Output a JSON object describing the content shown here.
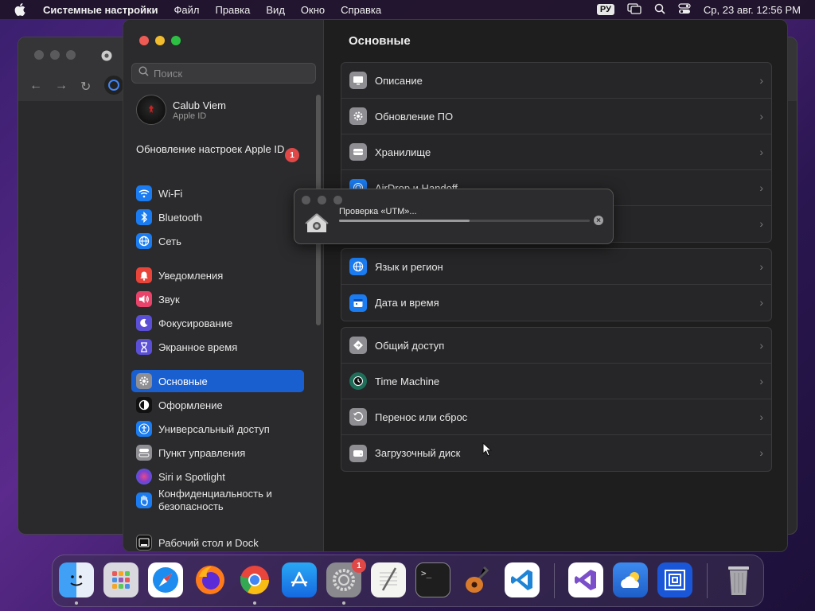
{
  "menubar": {
    "app_name": "Системные настройки",
    "items": [
      "Файл",
      "Правка",
      "Вид",
      "Окно",
      "Справка"
    ],
    "lang": "РУ",
    "datetime": "Ср, 23 авг.  12:56 PM"
  },
  "sidebar": {
    "search_placeholder": "Поиск",
    "profile_name": "Calub Viem",
    "profile_sub": "Apple ID",
    "update_text": "Обновление настроек Apple ID",
    "update_badge": "1",
    "items": [
      {
        "label": "Wi-Fi",
        "icon": "wifi-icon",
        "color": "#1a7cf0"
      },
      {
        "label": "Bluetooth",
        "icon": "bluetooth-icon",
        "color": "#1a7cf0"
      },
      {
        "label": "Сеть",
        "icon": "globe-icon",
        "color": "#1a7cf0"
      },
      {
        "label": "Уведомления",
        "icon": "bell-icon",
        "color": "#e8443a"
      },
      {
        "label": "Звук",
        "icon": "speaker-icon",
        "color": "#e8436a"
      },
      {
        "label": "Фокусирование",
        "icon": "moon-icon",
        "color": "#5b4fd6"
      },
      {
        "label": "Экранное время",
        "icon": "hourglass-icon",
        "color": "#5b4fd6"
      },
      {
        "label": "Основные",
        "icon": "gear-icon",
        "color": "#8e8e93"
      },
      {
        "label": "Оформление",
        "icon": "appearance-icon",
        "color": "#111111"
      },
      {
        "label": "Универсальный доступ",
        "icon": "accessibility-icon",
        "color": "#1a7cf0"
      },
      {
        "label": "Пункт управления",
        "icon": "control-center-icon",
        "color": "#8e8e93"
      },
      {
        "label": "Siri и Spotlight",
        "icon": "siri-icon",
        "color": "#7a3fd0"
      },
      {
        "label": "Конфиденциальность и безопасность",
        "icon": "hand-icon",
        "color": "#1a7cf0"
      },
      {
        "label": "Рабочий стол и Dock",
        "icon": "dock-icon",
        "color": "#111111"
      }
    ]
  },
  "content": {
    "title": "Основные",
    "group1": [
      {
        "label": "Описание",
        "icon": "display-icon"
      },
      {
        "label": "Обновление ПО",
        "icon": "gear-icon"
      },
      {
        "label": "Хранилище",
        "icon": "storage-icon"
      },
      {
        "label": "AirDrop и Handoff",
        "icon": "airdrop-icon"
      },
      {
        "label": "",
        "icon": ""
      }
    ],
    "group2": [
      {
        "label": "Язык и регион",
        "icon": "globe-icon"
      },
      {
        "label": "Дата и время",
        "icon": "calendar-icon"
      }
    ],
    "group3": [
      {
        "label": "Общий доступ",
        "icon": "sharing-icon"
      },
      {
        "label": "Time Machine",
        "icon": "time-machine-icon"
      },
      {
        "label": "Перенос или сброс",
        "icon": "reset-icon"
      },
      {
        "label": "Загрузочный диск",
        "icon": "disk-icon"
      }
    ]
  },
  "popup": {
    "text": "Проверка «UTM»...",
    "progress": 0.52
  },
  "dock": {
    "settings_badge": "1",
    "apps": [
      "finder-icon",
      "launchpad-icon",
      "safari-icon",
      "firefox-icon",
      "chrome-icon",
      "app-store-icon",
      "system-settings-icon",
      "textedit-icon",
      "terminal-icon",
      "garageband-icon",
      "vscode-icon",
      "visual-studio-icon",
      "weather-icon",
      "utm-icon",
      "trash-icon"
    ]
  }
}
